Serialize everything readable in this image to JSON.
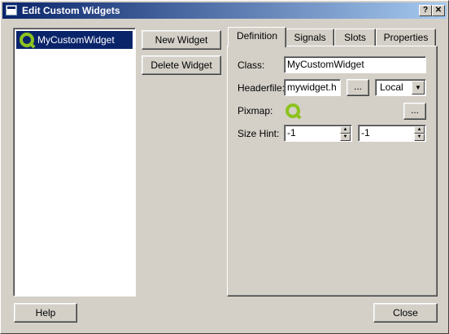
{
  "window": {
    "title": "Edit Custom Widgets",
    "help_glyph": "?",
    "close_glyph": "✕"
  },
  "widget_list": {
    "items": [
      {
        "label": "MyCustomWidget",
        "icon": "qt-logo-icon",
        "selected": true
      }
    ]
  },
  "buttons": {
    "new_widget": "New Widget",
    "delete_widget": "Delete Widget",
    "help": "Help",
    "close": "Close"
  },
  "tabs": [
    {
      "label": "Definition",
      "active": true
    },
    {
      "label": "Signals",
      "active": false
    },
    {
      "label": "Slots",
      "active": false
    },
    {
      "label": "Properties",
      "active": false
    }
  ],
  "definition": {
    "class_label": "Class:",
    "class_value": "MyCustomWidget",
    "headerfile_label": "Headerfile:",
    "headerfile_value": "mywidget.h",
    "browse_label": "...",
    "include_scope": "Local",
    "pixmap_label": "Pixmap:",
    "pixmap_browse_label": "...",
    "size_hint_label": "Size Hint:",
    "size_hint_width": "-1",
    "size_hint_height": "-1"
  },
  "colors": {
    "selection": "#0a246a",
    "qt_green": "#8dc21f",
    "face": "#d4d0c8"
  }
}
